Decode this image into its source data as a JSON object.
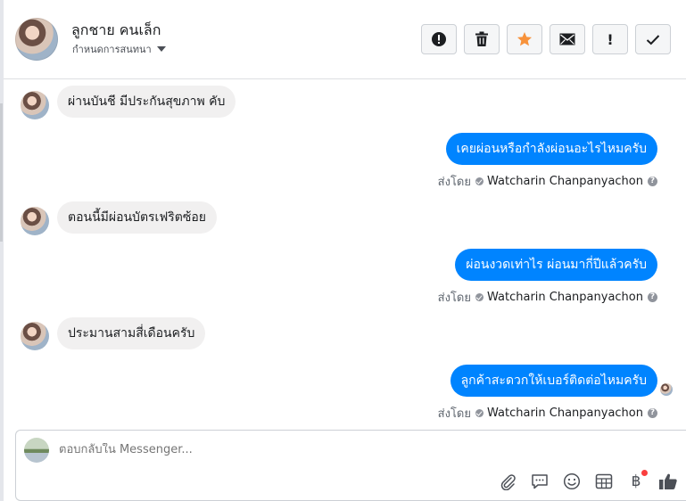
{
  "header": {
    "contact_name": "ลูกชาย คนเล็ก",
    "contact_sub": "กำหนดการสนทนา",
    "actions": [
      {
        "icon": "alert-circle-icon"
      },
      {
        "icon": "trash-icon"
      },
      {
        "icon": "star-icon",
        "color": "#f7923b"
      },
      {
        "icon": "envelope-icon"
      },
      {
        "icon": "exclamation-icon",
        "label": "!"
      },
      {
        "icon": "checkmark-icon"
      }
    ]
  },
  "messages": [
    {
      "direction": "in",
      "text": "ผ่านบันชี มีประกันสุขภาพ คับ"
    },
    {
      "direction": "out",
      "text": "เคยผ่อนหรือกำลังผ่อนอะไรไหมครับ",
      "sent_by_label": "ส่งโดย",
      "sender": "Watcharin Chanpanyachon",
      "help": "?"
    },
    {
      "direction": "in",
      "text": "ตอนนี้มีผ่อนบัตรเฟริตซ้อย"
    },
    {
      "direction": "out",
      "text": "ผ่อนงวดเท่าไร ผ่อนมากี่ปีแล้วครับ",
      "sent_by_label": "ส่งโดย",
      "sender": "Watcharin Chanpanyachon",
      "help": "?"
    },
    {
      "direction": "in",
      "text": "ประมานสามสี่เดือนครับ"
    },
    {
      "direction": "out",
      "text": "ลูกค้าสะดวกให้เบอร์ติดต่อไหมครับ",
      "sent_by_label": "ส่งโดย",
      "sender": "Watcharin Chanpanyachon",
      "help": "?"
    }
  ],
  "composer": {
    "placeholder": "ตอบกลับใน Messenger...",
    "tools": [
      "paperclip-icon",
      "speech-bubble-icon",
      "smiley-icon",
      "table-icon",
      "baht-icon",
      "thumbs-up-icon"
    ],
    "baht_symbol": "฿"
  },
  "colors": {
    "accent": "#0084ff",
    "incoming_bubble": "#f1f0f0",
    "star": "#f7923b",
    "notification_dot": "#fa3e3e"
  }
}
